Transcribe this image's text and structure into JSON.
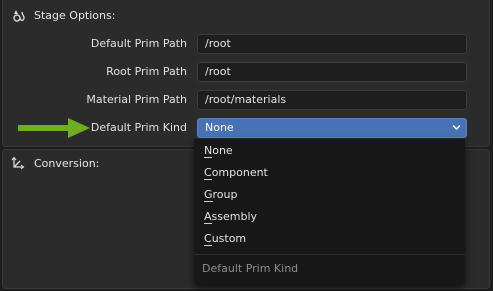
{
  "stage_options": {
    "title": "Stage Options:",
    "fields": [
      {
        "label": "Default Prim Path",
        "value": "/root"
      },
      {
        "label": "Root Prim Path",
        "value": "/root"
      },
      {
        "label": "Material Prim Path",
        "value": "/root/materials"
      }
    ],
    "kind": {
      "label": "Default Prim Kind",
      "value": "None"
    }
  },
  "conversion": {
    "title": "Conversion:"
  },
  "menu": {
    "items": [
      {
        "first": "N",
        "rest": "one"
      },
      {
        "first": "C",
        "rest": "omponent"
      },
      {
        "first": "G",
        "rest": "roup"
      },
      {
        "first": "A",
        "rest": "ssembly"
      },
      {
        "first": "C",
        "rest": "ustom"
      }
    ],
    "footer": "Default Prim Kind"
  },
  "colors": {
    "accent": "#4772b3",
    "arrow": "#6fae1e"
  },
  "icons": {
    "stage": "stage-options-icon",
    "conversion": "conversion-axes-icon",
    "dropdown": "chevron-down-icon",
    "pointer": "green-arrow-icon"
  }
}
